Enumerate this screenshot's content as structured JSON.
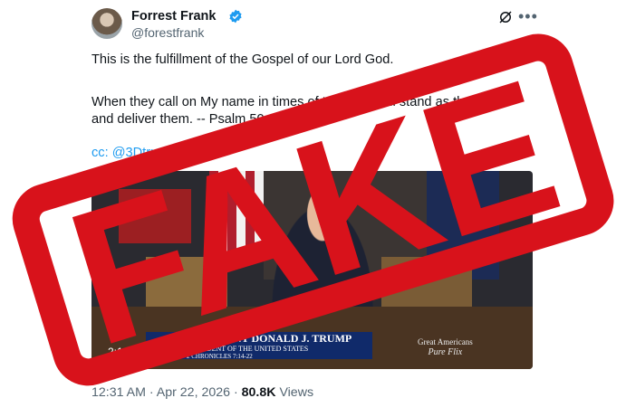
{
  "tweet": {
    "author_name": "Forrest Frank",
    "handle": "@forestfrank",
    "lines": [
      "This is the fulfillment of the Gospel of our Lord God.",
      "When they call on My name in times of trouble, I will stand as their God",
      "and deliver them. -- Psalm 50:15",
      "cc: @3Dtrumper"
    ],
    "timestamp": "12:31 AM · Apr 22, 2026 ·",
    "views_count": "80.8K",
    "views_label": "Views"
  },
  "video": {
    "duration": "2:19",
    "lower_third_name": "PRESIDENT DONALD J. TRUMP",
    "lower_third_title": "PRESIDENT OF THE UNITED STATES",
    "lower_third_ref": "2 CHRONICLES 7:14-22",
    "brand_line1": "Great Americans",
    "brand_line2": "Pure Flix"
  },
  "stamp": {
    "text": "FAKE",
    "color": "#d8121b"
  },
  "icons": [
    "verified-badge-icon",
    "grok-icon",
    "more-icon",
    "avatar"
  ]
}
